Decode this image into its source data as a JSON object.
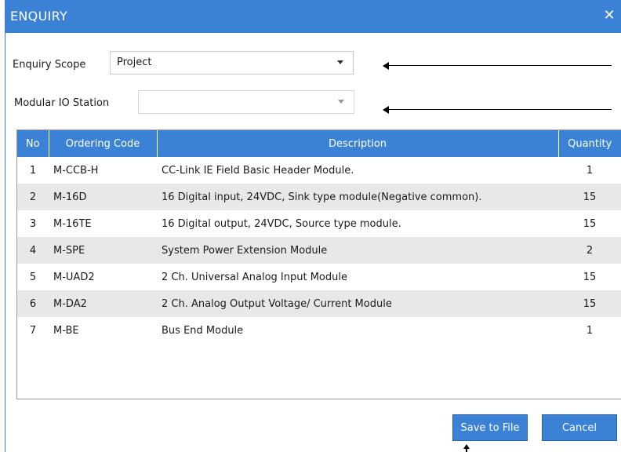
{
  "window": {
    "title": "ENQUIRY",
    "close_glyph": "✕"
  },
  "form": {
    "scope_label": "Enquiry Scope",
    "scope_value": "Project",
    "station_label": "Modular IO Station",
    "station_value": ""
  },
  "table": {
    "headers": [
      "No",
      "Ordering Code",
      "Description",
      "Quantity"
    ],
    "rows": [
      {
        "no": "1",
        "code": "M-CCB-H",
        "desc": "CC-Link IE Field Basic Header Module.",
        "qty": "1"
      },
      {
        "no": "2",
        "code": "M-16D",
        "desc": "16 Digital input, 24VDC, Sink type module(Negative common).",
        "qty": "15"
      },
      {
        "no": "3",
        "code": "M-16TE",
        "desc": "16 Digital output, 24VDC, Source type module.",
        "qty": "15"
      },
      {
        "no": "4",
        "code": "M-SPE",
        "desc": "System Power Extension Module",
        "qty": "2"
      },
      {
        "no": "5",
        "code": "M-UAD2",
        "desc": "2 Ch. Universal Analog Input Module",
        "qty": "15"
      },
      {
        "no": "6",
        "code": "M-DA2",
        "desc": "2 Ch. Analog Output Voltage/ Current Module",
        "qty": "15"
      },
      {
        "no": "7",
        "code": "M-BE",
        "desc": "Bus End Module",
        "qty": "1"
      }
    ]
  },
  "buttons": {
    "save_label": "Save to File",
    "cancel_label": "Cancel"
  },
  "colors": {
    "accent": "#3b82d6",
    "row_alt": "#e8e8e8",
    "border": "#9a9a9a"
  },
  "icons": {
    "close": "close-icon",
    "dropdown": "chevron-down-icon",
    "annotation": "arrow-left-icon"
  }
}
